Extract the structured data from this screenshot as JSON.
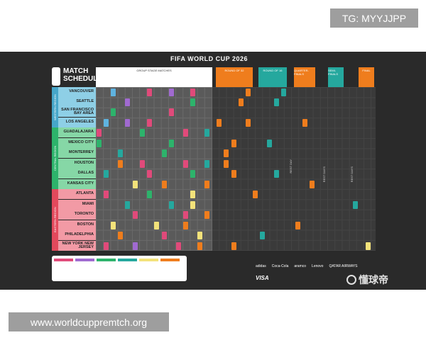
{
  "watermark_top": "TG: MYYJJPP",
  "watermark_bottom": "www.worldcuppremtch.org",
  "poster": {
    "title": "FIFA WORLD CUP 2026",
    "logo_text": "MATCH SCHEDULE",
    "header_group": "GROUP STAGE MATCHES",
    "header_r32": "ROUND OF 32",
    "header_r16": "ROUND OF 16",
    "header_qf": "QUARTER-FINALS",
    "header_sf": "SEMI-FINALS",
    "header_final": "FINAL",
    "regions": [
      "WESTERN REGION",
      "CENTRAL REGION",
      "EASTERN REGION"
    ],
    "cities": [
      "VANCOUVER",
      "SEATTLE",
      "SAN FRANCISCO BAY AREA",
      "LOS ANGELES",
      "GUADALAJARA",
      "MEXICO CITY",
      "MONTERREY",
      "HOUSTON",
      "DALLAS",
      "KANSAS CITY",
      "ATLANTA",
      "MIAMI",
      "TORONTO",
      "BOSTON",
      "PHILADELPHIA",
      "NEW YORK NEW JERSEY"
    ],
    "rest_labels": [
      "REST DAY",
      "REST DAYS",
      "REST DAYS"
    ],
    "sponsors": [
      "adidas",
      "Coca-Cola",
      "aramco",
      "Lenovo",
      "QATAR AIRWAYS",
      "VISA"
    ],
    "corner_mark": "懂球帝",
    "colors": {
      "background": "#2a2a2a",
      "western": "#46a6c9",
      "central": "#2db36b",
      "eastern": "#e2495c",
      "orange": "#ef7d1d",
      "teal": "#25a89e",
      "yellow": "#f3e27a"
    }
  }
}
